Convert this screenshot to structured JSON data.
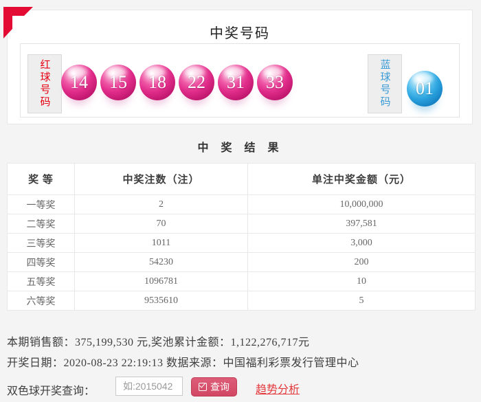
{
  "header": {
    "title": "中奖号码",
    "red_label": "红球号码",
    "blue_label": "蓝球号码",
    "red_balls": [
      "14",
      "15",
      "18",
      "22",
      "31",
      "33"
    ],
    "blue_ball": "01",
    "colors": {
      "corner_flag": "#e30b33",
      "red_label_text": "#e60012",
      "blue_label_text": "#3a9bd8",
      "red_ball": "#e02c8a",
      "blue_ball": "#2aa2de"
    }
  },
  "results": {
    "title": "中 奖 结 果",
    "columns": [
      "奖 等",
      "中奖注数（注）",
      "单注中奖金额（元）"
    ],
    "rows": [
      {
        "level": "一等奖",
        "count": "2",
        "amount": "10,000,000"
      },
      {
        "level": "二等奖",
        "count": "70",
        "amount": "397,581"
      },
      {
        "level": "三等奖",
        "count": "1011",
        "amount": "3,000"
      },
      {
        "level": "四等奖",
        "count": "54230",
        "amount": "200"
      },
      {
        "level": "五等奖",
        "count": "1096781",
        "amount": "10"
      },
      {
        "level": "六等奖",
        "count": "9535610",
        "amount": "5"
      }
    ]
  },
  "footer": {
    "sales_line": "本期销售额：375,199,530 元,奖池累计金额：1,122,276,717元",
    "date_line": "开奖日期：2020-08-23 22:19:13 数据来源：中国福利彩票发行管理中心",
    "query_label": "双色球开奖查询：",
    "input_placeholder": "如:2015042",
    "query_button_label": "查询",
    "trend_link_label": "趋势分析",
    "button_color": "#d14763",
    "link_color": "#e4393c"
  }
}
